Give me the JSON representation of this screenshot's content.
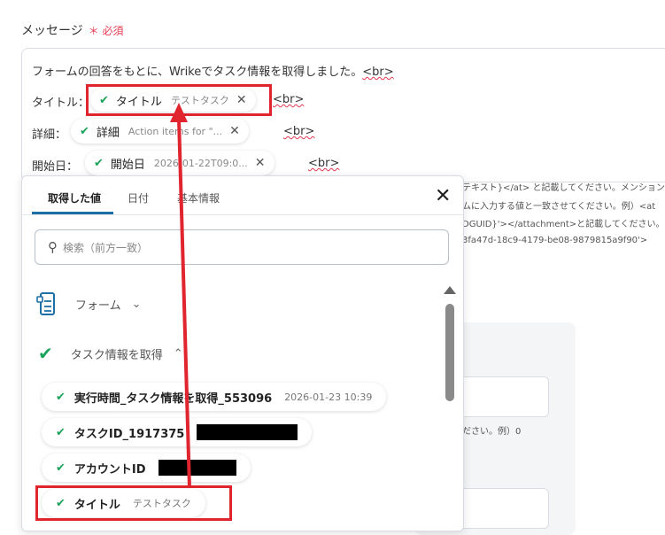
{
  "field": {
    "label": "メッセージ",
    "required_mark": "＊ 必須"
  },
  "message": {
    "line1": "フォームの回答をもとに、Wrikeでタスク情報を取得しました。",
    "br": "<br>",
    "title_label": "タイトル：",
    "detail_label": "詳細：",
    "start_label": "開始日：",
    "chips": {
      "title": {
        "name": "タイトル",
        "value": "テストタスク"
      },
      "detail": {
        "name": "詳細",
        "value": "Action items for \"..."
      },
      "start": {
        "name": "開始日",
        "value": "2026-01-22T09:0..."
      }
    }
  },
  "background_hints": {
    "l1": "テキスト}</at> と記載してください。メンション",
    "l2": "ムに入力する値と一致させてください。例）<at",
    "l3": "DGUID}'></attachment>と記載してください。",
    "l4": "3fa47d-18c9-4179-be08-9879815a9f90'>",
    "l5": "ださい。例）0"
  },
  "panel": {
    "tabs": [
      "取得した値",
      "日付",
      "基本情報"
    ],
    "search_placeholder": "検索（前方一致）",
    "sections": {
      "form": "フォーム",
      "wrike": "タスク情報を取得"
    },
    "items": [
      {
        "name": "実行時間_タスク情報を取得_553096",
        "value": "2026-01-23 10:39"
      },
      {
        "name": "タスクID_1917375",
        "value": ""
      },
      {
        "name": "アカウントID",
        "value": ""
      },
      {
        "name": "タイトル",
        "value": "テストタスク"
      }
    ]
  },
  "colors": {
    "accent": "#1e6fa6",
    "check": "#1aa35a",
    "highlight": "#e0252f",
    "required": "#e53950"
  }
}
